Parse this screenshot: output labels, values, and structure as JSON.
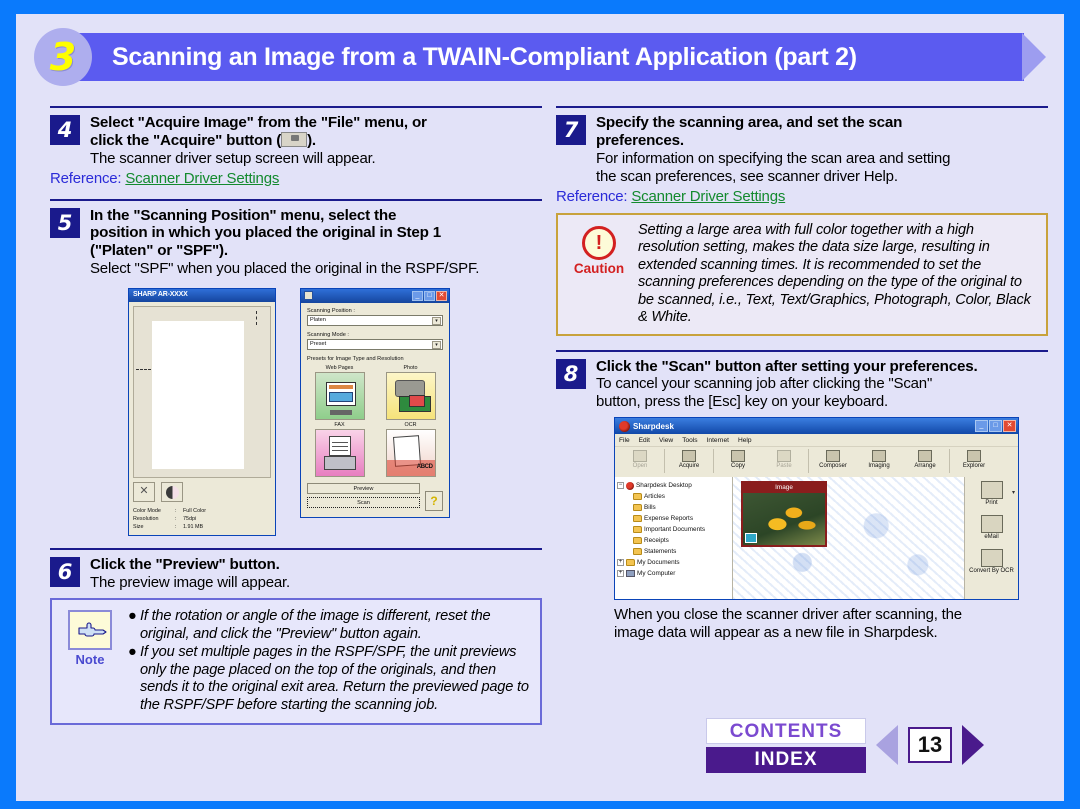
{
  "header": {
    "chapter_number": "3",
    "title": "Scanning an Image from a TWAIN-Compliant Application (part 2)"
  },
  "colors": {
    "page_border": "#0a7afc",
    "page_background": "#e2e2f8",
    "header_bar": "#5b5bf0",
    "step_badge": "#1a1a8c",
    "reference_label": "#2b2bd8",
    "reference_link": "#138a2e",
    "caution_accent": "#d32020",
    "note_accent": "#4a4ad0",
    "index_button": "#4a1a8c"
  },
  "steps": {
    "step4": {
      "number": "4",
      "title_line1": "Select \"Acquire Image\" from the \"File\" menu, or",
      "title_line2_prefix": "click the \"Acquire\" button (",
      "title_line2_suffix": ").",
      "acquire_button_caption": "Acquire",
      "sub": "The scanner driver setup screen will appear.",
      "reference_label": "Reference:",
      "reference_link": "Scanner Driver Settings"
    },
    "step5": {
      "number": "5",
      "title_line1": "In the \"Scanning Position\" menu, select the",
      "title_line2": "position in which you placed the original in Step 1",
      "title_line3": "(\"Platen\" or \"SPF\").",
      "sub": "Select \"SPF\" when you placed the original in the RSPF/SPF."
    },
    "step6": {
      "number": "6",
      "title": "Click the \"Preview\" button.",
      "sub": "The preview image will appear."
    },
    "step7": {
      "number": "7",
      "title_line1": "Specify the scanning area, and set the scan",
      "title_line2": "preferences.",
      "sub_line1": "For information on specifying the scan area and setting",
      "sub_line2": "the scan preferences, see scanner driver Help.",
      "reference_label": "Reference:",
      "reference_link": "Scanner Driver Settings"
    },
    "step8": {
      "number": "8",
      "title": "Click the \"Scan\" button after setting your preferences.",
      "sub_line1": "To cancel your scanning job after clicking the \"Scan\"",
      "sub_line2": "button, press the [Esc] key on your keyboard."
    }
  },
  "preview_window": {
    "title": "SHARP AR-XXXX",
    "tool_rotate": "rotate-icon",
    "tool_contrast": "contrast-icon",
    "info": [
      {
        "key": "Color Mode",
        "sep": ":",
        "value": "Full Color"
      },
      {
        "key": "Resolution",
        "sep": ":",
        "value": "75dpi"
      },
      {
        "key": "Size",
        "sep": ":",
        "value": "1.91 MB"
      }
    ]
  },
  "driver_window": {
    "minimize": "_",
    "maximize": "□",
    "close": "✕",
    "scanning_position_label": "Scanning Position :",
    "scanning_position_value": "Platen",
    "scanning_mode_label": "Scanning Mode :",
    "scanning_mode_value": "Preset",
    "presets_label": "Presets for Image Type and Resolution",
    "presets": [
      {
        "caption": "Web Pages"
      },
      {
        "caption": "Photo"
      },
      {
        "caption": "FAX"
      },
      {
        "caption": "OCR"
      }
    ],
    "preview_button": "Preview",
    "scan_button": "Scan",
    "help_button": "?"
  },
  "note": {
    "label": "Note",
    "bullet": "●",
    "items": [
      "If the rotation or angle of the image is different, reset the original, and click the \"Preview\" button again.",
      "If you set multiple pages in the RSPF/SPF, the unit previews only the page placed on the top of the originals, and then sends it to the original exit area. Return the previewed page to the RSPF/SPF before starting the scanning job."
    ]
  },
  "caution": {
    "label": "Caution",
    "mark": "!",
    "text": "Setting a large area with full color together with a high resolution setting, makes the data size large, resulting in extended scanning times. It is recommended to set the scanning preferences depending on the type of the original to be scanned, i.e., Text, Text/Graphics, Photograph, Color, Black & White."
  },
  "sharpdesk": {
    "title": "Sharpdesk",
    "minimize": "_",
    "maximize": "□",
    "close": "✕",
    "menus": [
      "File",
      "Edit",
      "View",
      "Tools",
      "Internet",
      "Help"
    ],
    "toolbar": [
      {
        "label": "Open",
        "disabled": true
      },
      {
        "label": "Acquire",
        "disabled": false
      },
      {
        "label": "Copy",
        "disabled": false
      },
      {
        "label": "Paste",
        "disabled": true
      },
      {
        "label": "Composer",
        "disabled": false
      },
      {
        "label": "Imaging",
        "disabled": false
      },
      {
        "label": "Arrange",
        "disabled": false
      },
      {
        "label": "Explorer",
        "disabled": false
      }
    ],
    "tree": [
      {
        "label": "Sharpdesk Desktop",
        "level": 0,
        "icon": "bug-icon",
        "expander": "-"
      },
      {
        "label": "Articles",
        "level": 1,
        "icon": "folder-icon"
      },
      {
        "label": "Bills",
        "level": 1,
        "icon": "folder-icon"
      },
      {
        "label": "Expense Reports",
        "level": 1,
        "icon": "folder-icon"
      },
      {
        "label": "Important Documents",
        "level": 1,
        "icon": "folder-icon"
      },
      {
        "label": "Receipts",
        "level": 1,
        "icon": "folder-icon"
      },
      {
        "label": "Statements",
        "level": 1,
        "icon": "folder-icon"
      },
      {
        "label": "My Documents",
        "level": 0,
        "icon": "folder-icon",
        "expander": "+"
      },
      {
        "label": "My Computer",
        "level": 0,
        "icon": "computer-icon",
        "expander": "+"
      }
    ],
    "thumbnail_caption": "Image",
    "right_panel": [
      {
        "label": "Print"
      },
      {
        "label": "eMail"
      },
      {
        "label": "Convert By OCR"
      }
    ]
  },
  "closing_text": {
    "line1": "When you close the scanner driver after scanning, the",
    "line2": "image data will appear as a new file in Sharpdesk."
  },
  "footer": {
    "contents": "CONTENTS",
    "index": "INDEX",
    "prev": "prev-arrow",
    "next": "next-arrow",
    "page_number": "13"
  }
}
